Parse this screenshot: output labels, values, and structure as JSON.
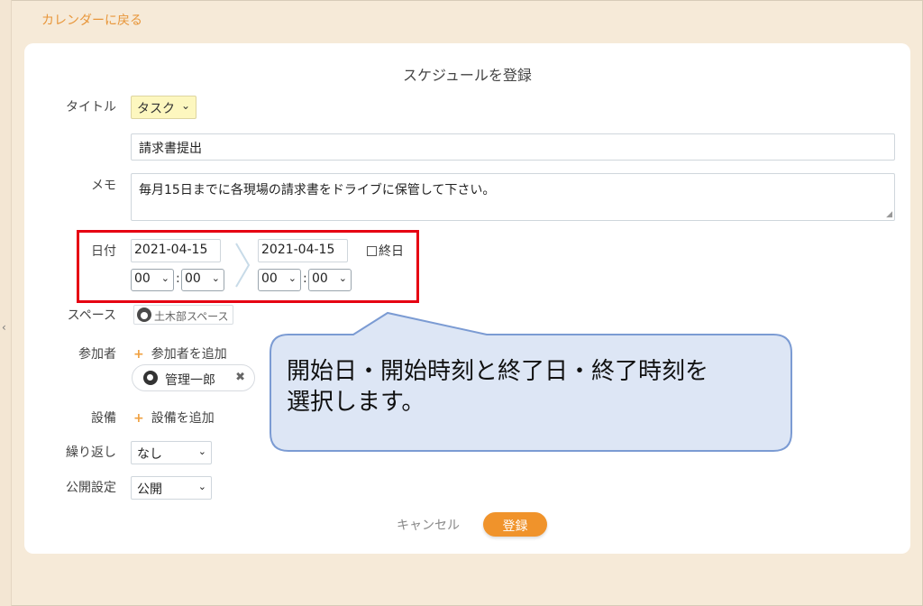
{
  "nav": {
    "back_label": "カレンダーに戻る"
  },
  "form": {
    "title": "スケジュールを登録",
    "title_field": {
      "label": "タイトル",
      "category": "タスク",
      "value": "請求書提出"
    },
    "memo": {
      "label": "メモ",
      "value": "毎月15日までに各現場の請求書をドライブに保管して下さい。"
    },
    "date": {
      "label": "日付",
      "start_date": "2021-04-15",
      "end_date": "2021-04-15",
      "start_hour": "00",
      "start_minute": "00",
      "end_hour": "00",
      "end_minute": "00",
      "separator": ":",
      "all_day_label": "終日"
    },
    "space": {
      "label": "スペース",
      "value": "土木部スペース"
    },
    "participants": {
      "label": "参加者",
      "add_label": "参加者を追加",
      "users": [
        "管理一郎"
      ]
    },
    "equipment": {
      "label": "設備",
      "add_label": "設備を追加"
    },
    "repeat": {
      "label": "繰り返し",
      "value": "なし"
    },
    "visibility": {
      "label": "公開設定",
      "value": "公開"
    },
    "cancel_label": "キャンセル",
    "submit_label": "登録"
  },
  "callout": {
    "line1": "開始日・開始時刻と終了日・終了時刻を",
    "line2": "選択します。"
  },
  "colors": {
    "accent": "#f0932b",
    "highlight": "#e60012",
    "callout_fill": "#dde6f5",
    "callout_border": "#7b9bd3",
    "background": "#f6ead8"
  },
  "icons": {
    "back": "left-chevron",
    "dropdown": "chevron-down",
    "range": "right-chevron",
    "add": "plus",
    "remove": "x-mark"
  }
}
